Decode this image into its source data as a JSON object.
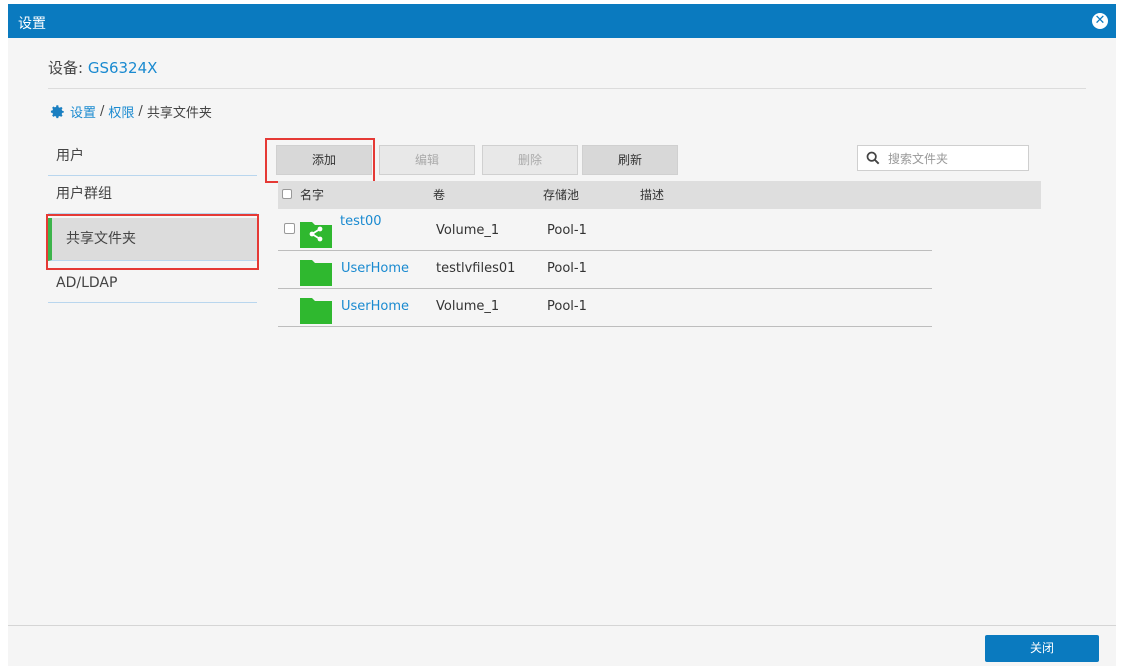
{
  "window": {
    "title": "设置"
  },
  "device": {
    "label": "设备: ",
    "name": "GS6324X"
  },
  "breadcrumb": {
    "items": [
      "设置",
      "权限",
      "共享文件夹"
    ],
    "separator": "/"
  },
  "sidebar": {
    "items": [
      {
        "label": "用户"
      },
      {
        "label": "用户群组"
      },
      {
        "label": "共享文件夹",
        "active": true
      },
      {
        "label": "AD/LDAP"
      }
    ]
  },
  "toolbar": {
    "add_label": "添加",
    "edit_label": "编辑",
    "delete_label": "删除",
    "refresh_label": "刷新"
  },
  "search": {
    "placeholder": "搜索文件夹",
    "value": ""
  },
  "table": {
    "columns": [
      "名字",
      "卷",
      "存储池",
      "描述"
    ],
    "rows": [
      {
        "name": "test00",
        "volume": "Volume_1",
        "pool": "Pool-1",
        "description": "",
        "shared": true
      },
      {
        "name": "UserHome",
        "volume": "testlvfiles01",
        "pool": "Pool-1",
        "description": "",
        "shared": false
      },
      {
        "name": "UserHome",
        "volume": "Volume_1",
        "pool": "Pool-1",
        "description": "",
        "shared": false
      }
    ]
  },
  "footer": {
    "close_label": "关闭"
  },
  "colors": {
    "titlebar": "#0a7abf",
    "link": "#1a8ad0",
    "folder": "#2fb82f",
    "highlight": "#e53935",
    "active_marker": "#3cb44b"
  }
}
